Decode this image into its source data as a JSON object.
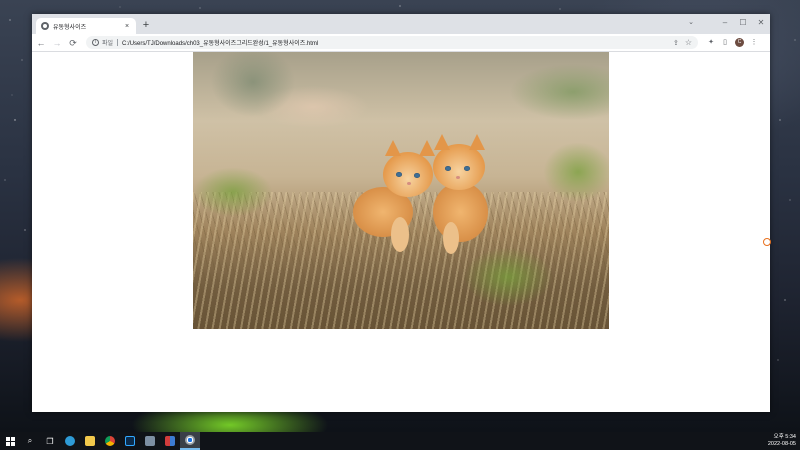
{
  "browser": {
    "tab": {
      "title": "유동형사이즈",
      "close_label": "×"
    },
    "new_tab_label": "+",
    "window_controls": {
      "tab_search": "⌄",
      "minimize": "–",
      "maximize": "☐",
      "close": "✕"
    },
    "nav": {
      "back": "←",
      "forward": "→",
      "reload": "⟳"
    },
    "address": {
      "scheme_label": "파일",
      "url": "C:/Users/TJ/Downloads/ch03_유동형사이즈그리드완성/1_유동형사이즈.html"
    },
    "toolbar_icons": {
      "share": "⇪",
      "bookmark": "☆",
      "extensions": "✦",
      "side_panel": "▯",
      "profile_initial": "C",
      "menu": "⋮"
    }
  },
  "page": {
    "image_alt": "Two orange tabby kittens walking on dry grass"
  },
  "taskbar": {
    "apps": [
      "search-icon",
      "task-view-icon",
      "edge-icon",
      "file-explorer-icon",
      "chrome-icon",
      "photoshop-icon",
      "app-icon",
      "app-icon-2",
      "chrome-active-icon"
    ],
    "clock": {
      "time": "오후 5:34",
      "date": "2022-08-05"
    }
  },
  "colors": {
    "taskbar_bg": "#101318",
    "tabstrip_bg": "#dee1e6",
    "omnibox_bg": "#f1f3f4",
    "kitten_orange": "#e8a35a"
  }
}
